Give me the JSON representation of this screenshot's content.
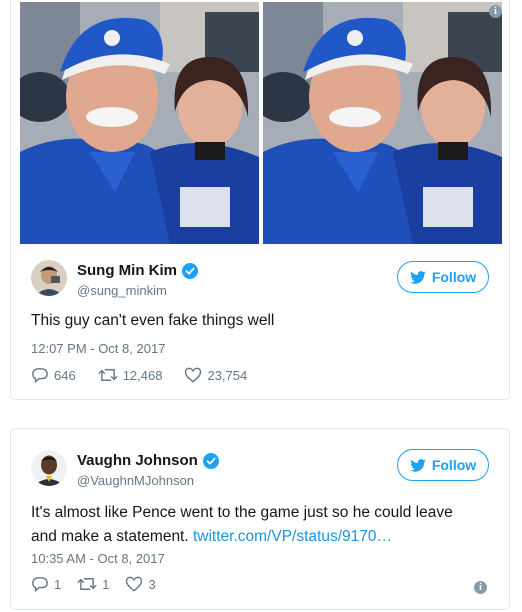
{
  "tweets": [
    {
      "user_name": "Sung Min Kim",
      "user_handle": "@sung_minkim",
      "follow_label": "Follow",
      "text": "This guy can't even fake things well",
      "timestamp": "12:07 PM - Oct 8, 2017",
      "replies": "646",
      "retweets": "12,468",
      "likes": "23,754",
      "media_count": 2
    },
    {
      "user_name": "Vaughn Johnson",
      "user_handle": "@VaughnMJohnson",
      "follow_label": "Follow",
      "text_line1": "It's almost like Pence went to the game just so he could leave",
      "text_line2": "and make a statement.",
      "link": "twitter.com/VP/status/9170…",
      "timestamp": "10:35 AM - Oct 8, 2017",
      "replies": "1",
      "retweets": "1",
      "likes": "3"
    }
  ],
  "colors": {
    "twitter_blue": "#1da1f2",
    "link_blue": "#1b95e0",
    "muted_gray": "#657786",
    "colts_blue": "#1f4fb8"
  },
  "icons": {
    "info": "info-icon",
    "verified": "verified-badge-icon",
    "twitter_bird": "twitter-bird-icon",
    "reply": "reply-icon",
    "retweet": "retweet-icon",
    "like": "heart-icon"
  }
}
